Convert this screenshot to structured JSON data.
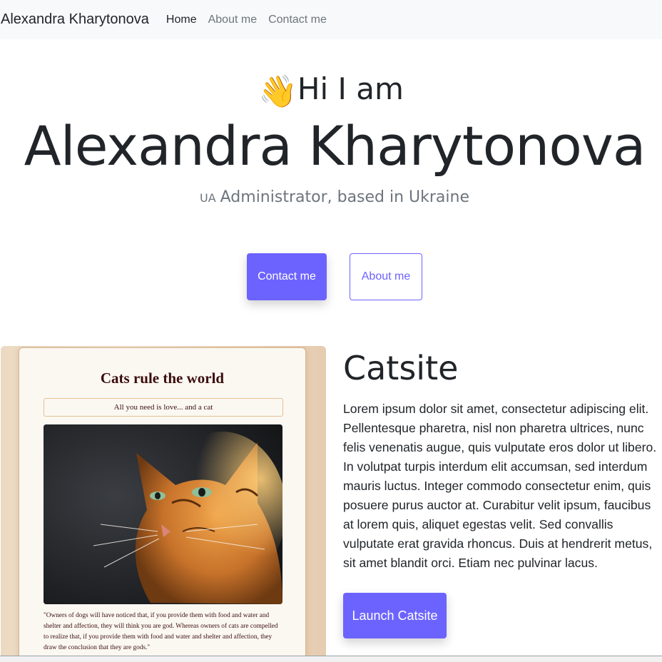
{
  "navbar": {
    "brand": "Alexandra Kharytonova",
    "links": [
      {
        "label": "Home",
        "active": true
      },
      {
        "label": "About me",
        "active": false
      },
      {
        "label": "Contact me",
        "active": false
      }
    ]
  },
  "hero": {
    "wave_emoji": "👋",
    "greeting": "Hi I am",
    "name": "Alexandra Kharytonova",
    "flag": "UA",
    "subtitle": "Administrator, based in Ukraine",
    "contact_button": "Contact me",
    "about_button": "About me"
  },
  "project": {
    "preview": {
      "title": "Cats rule the world",
      "tagline": "All you need is love... and a cat",
      "quote": "\"Owners of dogs will have noticed that, if you provide them with food and water and shelter and affection, they will think you are god. Whereas owners of cats are compelled to realize that, if you provide them with food and water and shelter and affection, they draw the conclusion that they are gods.\""
    },
    "title": "Catsite",
    "description": "Lorem ipsum dolor sit amet, consectetur adipiscing elit. Pellentesque pharetra, nisl non pharetra ultrices, nunc felis venenatis augue, quis vulputate eros dolor ut libero. In volutpat turpis interdum elit accumsan, sed interdum mauris luctus. Integer commodo consectetur enim, quis posuere purus auctor at. Curabitur velit ipsum, faucibus at lorem quis, aliquet egestas velit. Sed convallis vulputate erat gravida rhoncus. Duis at hendrerit metus, sit amet blandit orci. Etiam nec pulvinar lacus.",
    "launch_button": "Launch Catsite"
  },
  "colors": {
    "accent": "#6c63ff",
    "navbar_bg": "#f8f9fa",
    "text": "#212529",
    "muted": "#6c757d"
  }
}
